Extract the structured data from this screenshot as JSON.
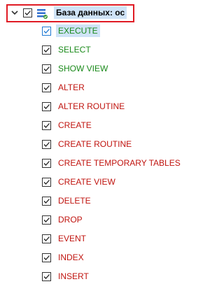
{
  "root": {
    "label": "База данных: ос",
    "expanded": true,
    "checked": true,
    "icon": "database-icon"
  },
  "colors": {
    "granted": "#1a8a1a",
    "revoked": "#c0140f",
    "selection": "#cfe3f7",
    "highlight_border": "#e01b24"
  },
  "privileges": [
    {
      "label": "EXECUTE",
      "checked": true,
      "state": "granted",
      "selected": true
    },
    {
      "label": "SELECT",
      "checked": true,
      "state": "granted"
    },
    {
      "label": "SHOW VIEW",
      "checked": true,
      "state": "granted"
    },
    {
      "label": "ALTER",
      "checked": true,
      "state": "revoked"
    },
    {
      "label": "ALTER ROUTINE",
      "checked": true,
      "state": "revoked"
    },
    {
      "label": "CREATE",
      "checked": true,
      "state": "revoked"
    },
    {
      "label": "CREATE ROUTINE",
      "checked": true,
      "state": "revoked"
    },
    {
      "label": "CREATE TEMPORARY TABLES",
      "checked": true,
      "state": "revoked"
    },
    {
      "label": "CREATE VIEW",
      "checked": true,
      "state": "revoked"
    },
    {
      "label": "DELETE",
      "checked": true,
      "state": "revoked"
    },
    {
      "label": "DROP",
      "checked": true,
      "state": "revoked"
    },
    {
      "label": "EVENT",
      "checked": true,
      "state": "revoked"
    },
    {
      "label": "INDEX",
      "checked": true,
      "state": "revoked"
    },
    {
      "label": "INSERT",
      "checked": true,
      "state": "revoked"
    }
  ]
}
